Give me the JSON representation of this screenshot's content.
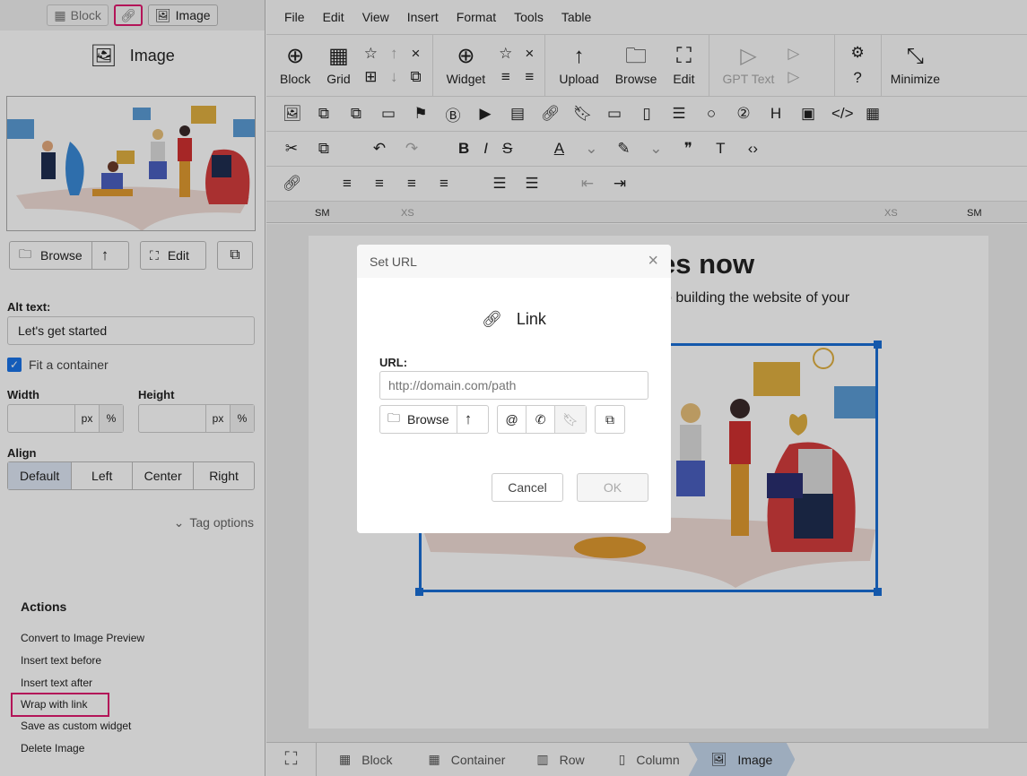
{
  "left_panel": {
    "top_tabs": [
      {
        "label": "Block",
        "icon": "grid-icon"
      },
      {
        "label": "",
        "icon": "link-icon"
      },
      {
        "label": "Image",
        "icon": "image-icon"
      }
    ],
    "title": "Image",
    "browse_label": "Browse",
    "edit_label": "Edit",
    "alt_text_label": "Alt text:",
    "alt_text_value": "Let's get started",
    "fit_label": "Fit a container",
    "fit_checked": true,
    "width_label": "Width",
    "height_label": "Height",
    "unit_px": "px",
    "unit_pct": "%",
    "align_label": "Align",
    "align_options": [
      "Default",
      "Left",
      "Center",
      "Right"
    ],
    "align_selected": "Default",
    "tag_options": "Tag options",
    "actions_title": "Actions",
    "actions": [
      "Convert to Image Preview",
      "Insert text before",
      "Insert text after",
      "Wrap with link",
      "Save as custom widget",
      "Delete Image"
    ],
    "highlight_color": "#e0196e"
  },
  "menu": [
    "File",
    "Edit",
    "View",
    "Insert",
    "Format",
    "Tools",
    "Table"
  ],
  "ribbon": {
    "block": "Block",
    "grid": "Grid",
    "widget": "Widget",
    "upload": "Upload",
    "browse": "Browse",
    "edit": "Edit",
    "gpt": "GPT Text",
    "minimize": "Minimize"
  },
  "ruler": {
    "left_sm": "SM",
    "left_xs": "XS",
    "right_xs": "XS",
    "right_sm": "SM"
  },
  "page": {
    "heading": "es now",
    "subtext": "o building the website of your"
  },
  "modal": {
    "title": "Set URL",
    "heading": "Link",
    "url_label": "URL:",
    "url_placeholder": "http://domain.com/path",
    "url_value": "",
    "browse": "Browse",
    "at": "@",
    "cancel": "Cancel",
    "ok": "OK"
  },
  "breadcrumb": [
    "Block",
    "Container",
    "Row",
    "Column",
    "Image"
  ],
  "selection_color": "#1a6fd6"
}
